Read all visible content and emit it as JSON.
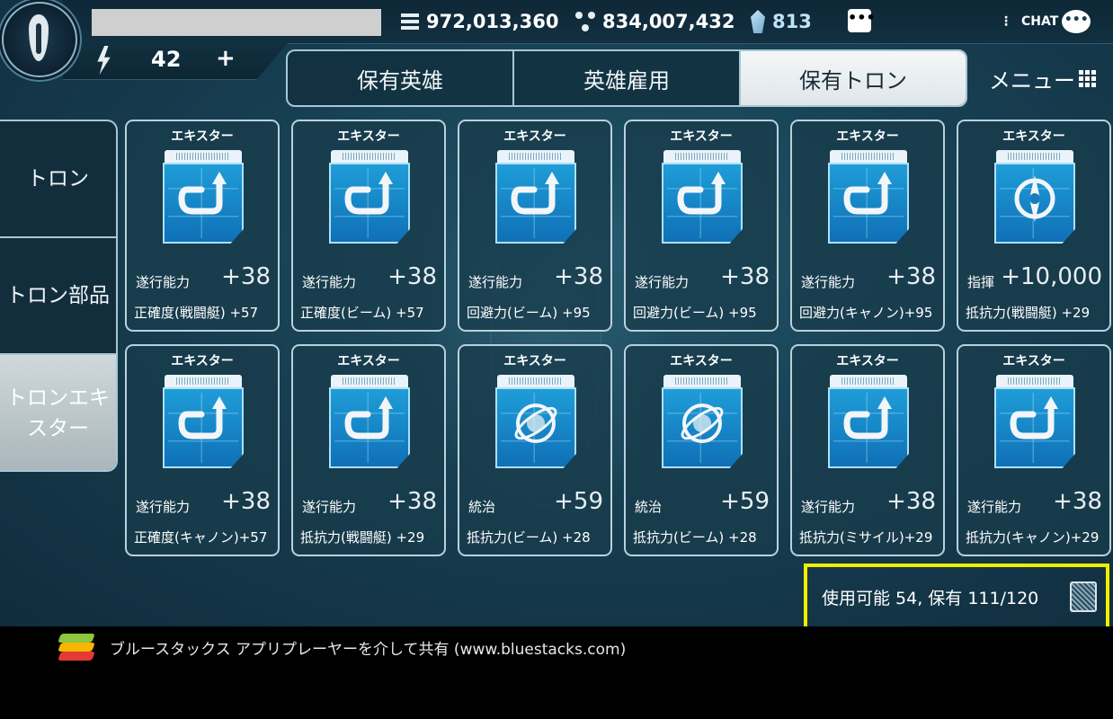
{
  "resources": {
    "credits": "972,013,360",
    "materials": "834,007,432",
    "crystals": "813"
  },
  "energy": {
    "value": "42",
    "plus": "+"
  },
  "header": {
    "more": "•••",
    "chat": "CHAT"
  },
  "tabs": [
    "保有英雄",
    "英雄雇用",
    "保有トロン"
  ],
  "menu_label": "メニュー",
  "side": [
    "トロン",
    "トロン部品",
    "トロンエキ\nスター"
  ],
  "cards": [
    {
      "title": "エキスター",
      "icon": "arrow-chip-icon",
      "s1": "遂行能力",
      "v1": "+38",
      "s2": "正確度(戦闘艇) +57"
    },
    {
      "title": "エキスター",
      "icon": "arrow-chip-icon",
      "s1": "遂行能力",
      "v1": "+38",
      "s2": "正確度(ビーム) +57"
    },
    {
      "title": "エキスター",
      "icon": "arrow-chip-icon",
      "s1": "遂行能力",
      "v1": "+38",
      "s2": "回避力(ビーム) +95"
    },
    {
      "title": "エキスター",
      "icon": "arrow-chip-icon",
      "s1": "遂行能力",
      "v1": "+38",
      "s2": "回避力(ビーム) +95"
    },
    {
      "title": "エキスター",
      "icon": "arrow-chip-icon",
      "s1": "遂行能力",
      "v1": "+38",
      "s2": "回避力(キャノン)+95"
    },
    {
      "title": "エキスター",
      "icon": "command-chip-icon",
      "s1": "指揮",
      "v1": "+10,000",
      "s2": "抵抗力(戦闘艇) +29"
    },
    {
      "title": "エキスター",
      "icon": "arrow-chip-icon",
      "s1": "遂行能力",
      "v1": "+38",
      "s2": "正確度(キャノン)+57"
    },
    {
      "title": "エキスター",
      "icon": "arrow-chip-icon",
      "s1": "遂行能力",
      "v1": "+38",
      "s2": "抵抗力(戦闘艇) +29"
    },
    {
      "title": "エキスター",
      "icon": "planet-chip-icon",
      "s1": "統治",
      "v1": "+59",
      "s2": "抵抗力(ビーム) +28"
    },
    {
      "title": "エキスター",
      "icon": "planet-chip-icon",
      "s1": "統治",
      "v1": "+59",
      "s2": "抵抗力(ビーム) +28"
    },
    {
      "title": "エキスター",
      "icon": "arrow-chip-icon",
      "s1": "遂行能力",
      "v1": "+38",
      "s2": "抵抗力(ミサイル)+29"
    },
    {
      "title": "エキスター",
      "icon": "arrow-chip-icon",
      "s1": "遂行能力",
      "v1": "+38",
      "s2": "抵抗力(キャノン)+29"
    }
  ],
  "capacity": "使用可能 54, 保有 111/120",
  "bluestacks": "ブルースタックス アプリプレーヤーを介して共有 (www.bluestacks.com)"
}
